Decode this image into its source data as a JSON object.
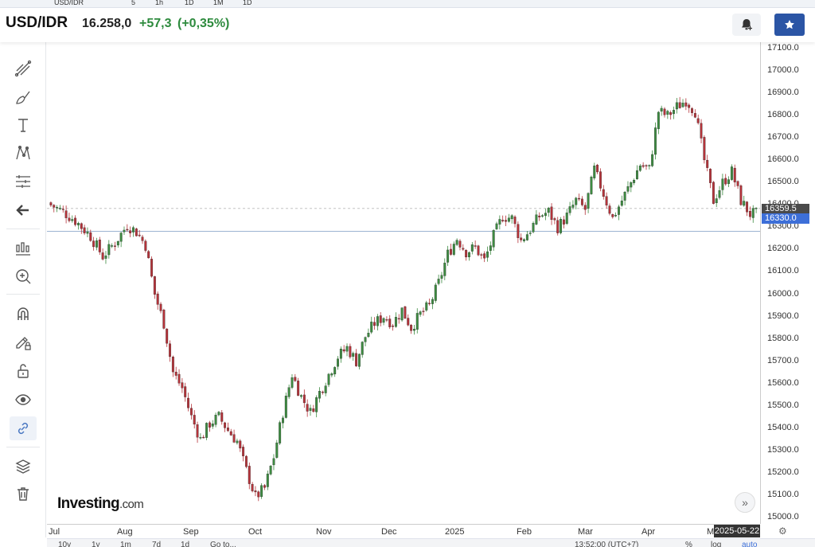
{
  "top_strip": [
    "USD/IDR",
    "5",
    "1h",
    "1D",
    "1M",
    "1D"
  ],
  "header": {
    "symbol": "USD/IDR",
    "price": "16.258,0",
    "change": "+57,3",
    "change_pct": "(+0,35%)"
  },
  "toolbar": {
    "icons": [
      "trend-line-icon",
      "brush-icon",
      "text-icon",
      "pattern-icon",
      "measure-icon",
      "back-arrow-icon",
      "indicator-icon",
      "zoom-in-icon",
      "magnet-icon",
      "pencil-lock-icon",
      "unlock-icon",
      "eye-icon",
      "link-icon",
      "layers-icon",
      "trash-icon"
    ]
  },
  "chart": {
    "logo_main": "Investing",
    "logo_suffix": ".com",
    "y_ticks": [
      "17100.0",
      "17000.0",
      "16900.0",
      "16800.0",
      "16700.0",
      "16600.0",
      "16500.0",
      "16400.0",
      "16300.0",
      "16200.0",
      "16100.0",
      "16000.0",
      "15900.0",
      "15800.0",
      "15700.0",
      "15600.0",
      "15500.0",
      "15400.0",
      "15300.0",
      "15200.0",
      "15100.0",
      "15000.0"
    ],
    "x_ticks": [
      "Jul",
      "Aug",
      "Sep",
      "Oct",
      "Nov",
      "Dec",
      "2025",
      "Feb",
      "Mar",
      "Apr",
      "M"
    ],
    "price_label_1": "16359.5",
    "price_label_2": "16330.0",
    "date_label": "2025-05-22",
    "colors": {
      "up": "#3d8b41",
      "down": "#b5333a",
      "crosshair": "#9cb3d1"
    }
  },
  "bottom_bar": {
    "ranges": [
      "10y",
      "1y",
      "1m",
      "7d",
      "1d",
      "Go to..."
    ],
    "time": "13:52:00 (UTC+7)",
    "pct": "%",
    "log": "log",
    "auto": "auto"
  },
  "chart_data": {
    "type": "candlestick",
    "title": "USD/IDR",
    "ylim": [
      14970,
      17130
    ],
    "x_labels": [
      "Jul",
      "Aug",
      "Sep",
      "Oct",
      "Nov",
      "Dec",
      "2025",
      "Feb",
      "Mar",
      "Apr",
      "M"
    ],
    "close_path": [
      [
        0,
        16400
      ],
      [
        4,
        16370
      ],
      [
        8,
        16330
      ],
      [
        13,
        16260
      ],
      [
        17,
        16170
      ],
      [
        21,
        16230
      ],
      [
        25,
        16310
      ],
      [
        28,
        16280
      ],
      [
        31,
        16220
      ],
      [
        34,
        16000
      ],
      [
        37,
        15870
      ],
      [
        40,
        15650
      ],
      [
        43,
        15580
      ],
      [
        46,
        15450
      ],
      [
        49,
        15350
      ],
      [
        52,
        15420
      ],
      [
        55,
        15450
      ],
      [
        58,
        15390
      ],
      [
        61,
        15340
      ],
      [
        64,
        15210
      ],
      [
        67,
        15090
      ],
      [
        70,
        15130
      ],
      [
        73,
        15270
      ],
      [
        76,
        15470
      ],
      [
        79,
        15640
      ],
      [
        82,
        15540
      ],
      [
        85,
        15470
      ],
      [
        88,
        15560
      ],
      [
        91,
        15640
      ],
      [
        94,
        15720
      ],
      [
        97,
        15760
      ],
      [
        100,
        15700
      ],
      [
        103,
        15810
      ],
      [
        106,
        15870
      ],
      [
        109,
        15900
      ],
      [
        112,
        15870
      ],
      [
        115,
        15930
      ],
      [
        118,
        15850
      ],
      [
        121,
        15910
      ],
      [
        124,
        15950
      ],
      [
        127,
        16050
      ],
      [
        130,
        16180
      ],
      [
        133,
        16250
      ],
      [
        136,
        16190
      ],
      [
        139,
        16210
      ],
      [
        142,
        16150
      ],
      [
        145,
        16260
      ],
      [
        148,
        16350
      ],
      [
        151,
        16340
      ],
      [
        154,
        16240
      ],
      [
        157,
        16290
      ],
      [
        160,
        16350
      ],
      [
        163,
        16370
      ],
      [
        166,
        16300
      ],
      [
        169,
        16350
      ],
      [
        172,
        16420
      ],
      [
        175,
        16380
      ],
      [
        178,
        16560
      ],
      [
        181,
        16450
      ],
      [
        184,
        16340
      ],
      [
        187,
        16420
      ],
      [
        190,
        16500
      ],
      [
        193,
        16580
      ],
      [
        196,
        16560
      ],
      [
        199,
        16820
      ],
      [
        202,
        16800
      ],
      [
        205,
        16840
      ],
      [
        208,
        16870
      ],
      [
        211,
        16820
      ],
      [
        214,
        16600
      ],
      [
        217,
        16420
      ],
      [
        220,
        16500
      ],
      [
        223,
        16550
      ],
      [
        226,
        16420
      ],
      [
        229,
        16360
      ]
    ]
  }
}
